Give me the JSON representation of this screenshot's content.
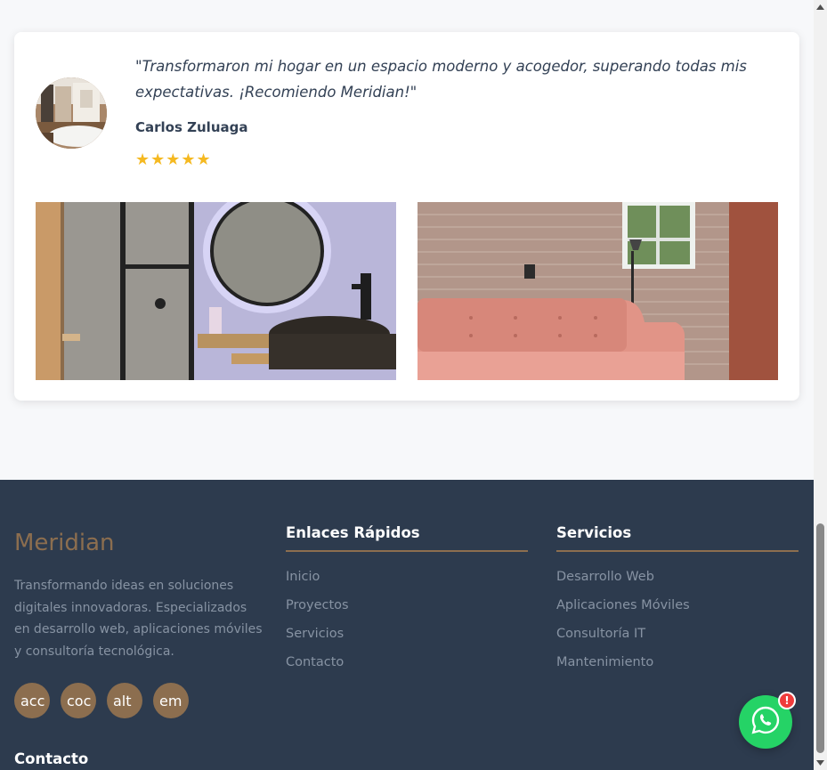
{
  "testimonial": {
    "quote": "\"Transformaron mi hogar en un espacio moderno y acogedor, superando todas mis expectativas. ¡Recomiendo Meridian!\"",
    "author": "Carlos Zuluaga",
    "stars": "★★★★★",
    "rating": 5,
    "avatar_icon": "avatar-photo",
    "photos": [
      "bathroom-photo",
      "living-room-photo"
    ]
  },
  "footer": {
    "brand": "Meridian",
    "about": "Transformando ideas en soluciones digitales innovadoras. Especializados en desarrollo web, aplicaciones móviles y consultoría tecnológica.",
    "socials": [
      "acc",
      "coc",
      "alt",
      "em"
    ],
    "links": {
      "title": "Enlaces Rápidos",
      "items": [
        "Inicio",
        "Proyectos",
        "Servicios",
        "Contacto"
      ]
    },
    "services": {
      "title": "Servicios",
      "items": [
        "Desarrollo Web",
        "Aplicaciones Móviles",
        "Consultoría IT",
        "Mantenimiento"
      ]
    },
    "contact_title": "Contacto"
  },
  "whatsapp": {
    "badge": "!",
    "icon": "whatsapp-icon"
  },
  "colors": {
    "accent": "#8c6e4f",
    "footer_bg": "#2d3b4e",
    "star": "#f5b921",
    "whatsapp": "#25d366"
  }
}
